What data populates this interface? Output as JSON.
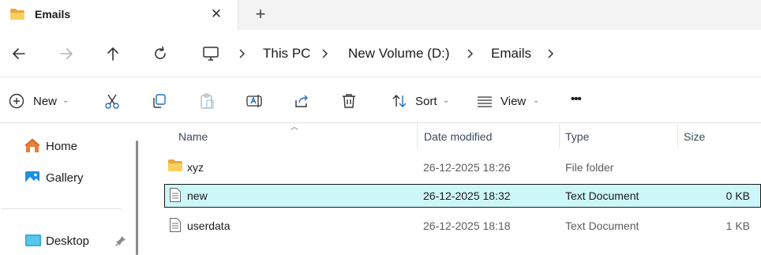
{
  "window": {
    "tab_title": "Emails",
    "close_tab": "✕",
    "new_tab": "+"
  },
  "address": {
    "crumbs": [
      "This PC",
      "New Volume (D:)",
      "Emails"
    ]
  },
  "commands": {
    "new_label": "New",
    "sort_label": "Sort",
    "view_label": "View",
    "more_label": "•••"
  },
  "sidebar": {
    "items": [
      {
        "label": "Home",
        "icon": "home-icon"
      },
      {
        "label": "Gallery",
        "icon": "gallery-icon"
      },
      {
        "label": "Desktop",
        "icon": "desktop-icon",
        "pinned": true
      }
    ]
  },
  "table": {
    "columns": [
      "Name",
      "Date modified",
      "Type",
      "Size"
    ],
    "rows": [
      {
        "name": "xyz",
        "date": "26-12-2025 18:26",
        "type": "File folder",
        "size": "",
        "icon": "folder-icon",
        "selected": false
      },
      {
        "name": "new",
        "date": "26-12-2025 18:32",
        "type": "Text Document",
        "size": "0 KB",
        "icon": "text-file-icon",
        "selected": true
      },
      {
        "name": "userdata",
        "date": "26-12-2025 18:18",
        "type": "Text Document",
        "size": "1 KB",
        "icon": "text-file-icon",
        "selected": false
      }
    ]
  },
  "colors": {
    "folder": "#f4c44e",
    "selection": "#cdf6f7",
    "accent": "#0067c0"
  }
}
